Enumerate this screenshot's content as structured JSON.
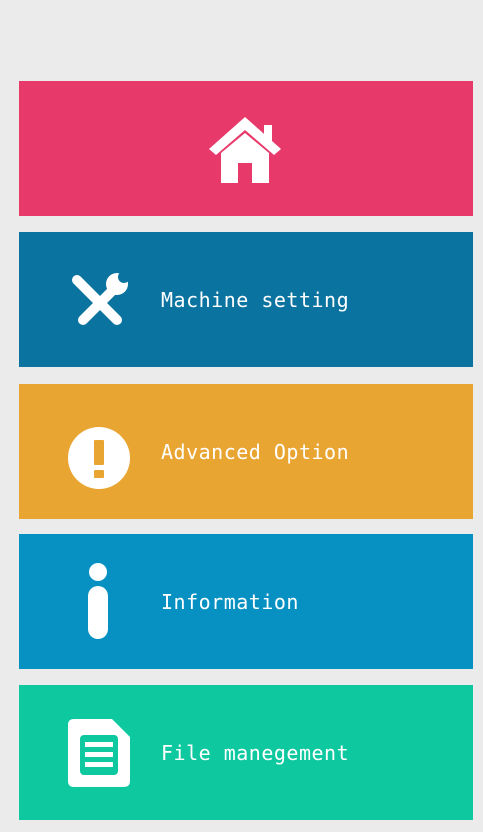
{
  "menu": {
    "home": {
      "icon": "home-icon",
      "color": "#e8396b"
    },
    "machine_setting": {
      "label": "Machine setting",
      "icon": "wrench-screwdriver-icon",
      "color": "#0a73a0"
    },
    "advanced_option": {
      "label": "Advanced Option",
      "icon": "exclamation-circle-icon",
      "color": "#e9a532"
    },
    "information": {
      "label": "Information",
      "icon": "info-icon",
      "color": "#0691c2"
    },
    "file_management": {
      "label": "File manegement",
      "icon": "document-list-icon",
      "color": "#0ec8a0"
    }
  }
}
